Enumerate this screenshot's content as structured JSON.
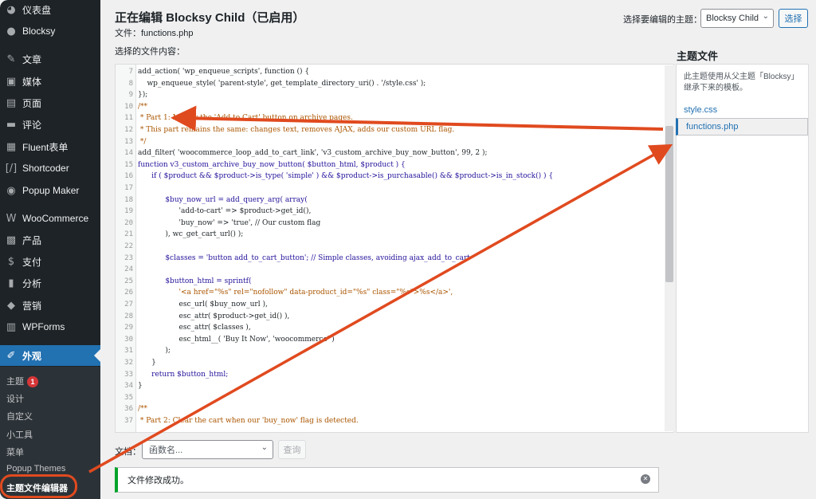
{
  "sidebar": {
    "items": [
      {
        "label": "仪表盘",
        "icon": "dashboard-icon",
        "glyph": "◕"
      },
      {
        "label": "Blocksy",
        "icon": "blocksy-icon",
        "glyph": "●"
      },
      {
        "label": "文章",
        "icon": "pin-icon",
        "glyph": "✎"
      },
      {
        "label": "媒体",
        "icon": "media-icon",
        "glyph": "▣"
      },
      {
        "label": "页面",
        "icon": "page-icon",
        "glyph": "▤"
      },
      {
        "label": "评论",
        "icon": "comment-icon",
        "glyph": "▬"
      },
      {
        "label": "Fluent表单",
        "icon": "form-icon",
        "glyph": "▦"
      },
      {
        "label": "Shortcoder",
        "icon": "shortcode-icon",
        "glyph": "[/]"
      },
      {
        "label": "Popup Maker",
        "icon": "popup-icon",
        "glyph": "◉"
      },
      {
        "label": "WooCommerce",
        "icon": "woocommerce-icon",
        "glyph": "W"
      },
      {
        "label": "产品",
        "icon": "product-icon",
        "glyph": "▩"
      },
      {
        "label": "支付",
        "icon": "payment-icon",
        "glyph": "$"
      },
      {
        "label": "分析",
        "icon": "analytics-icon",
        "glyph": "▮"
      },
      {
        "label": "营销",
        "icon": "marketing-icon",
        "glyph": "◆"
      },
      {
        "label": "WPForms",
        "icon": "wpforms-icon",
        "glyph": "▥"
      },
      {
        "label": "外观",
        "icon": "appearance-icon",
        "glyph": "✐"
      }
    ],
    "submenu": [
      {
        "label": "主题",
        "badge": "1"
      },
      {
        "label": "设计"
      },
      {
        "label": "自定义"
      },
      {
        "label": "小工具"
      },
      {
        "label": "菜单"
      },
      {
        "label": "Popup Themes"
      },
      {
        "label": "主题文件编辑器"
      }
    ]
  },
  "header": {
    "title": "正在编辑 Blocksy Child（已启用）",
    "file_label": "文件：",
    "file_name": "functions.php",
    "select_theme_label": "选择要编辑的主题：",
    "theme_selected": "Blocksy Child",
    "select_button": "选择"
  },
  "editor": {
    "label": "选择的文件内容：",
    "lines": [
      {
        "n": "7",
        "t": "add_action( 'wp_enqueue_scripts', function () {",
        "k": "plain"
      },
      {
        "n": "8",
        "t": "    wp_enqueue_style( 'parent-style', get_template_directory_uri() . '/style.css' );",
        "k": "plain"
      },
      {
        "n": "9",
        "t": "});",
        "k": "plain"
      },
      {
        "n": "10",
        "t": "/**",
        "k": "comment"
      },
      {
        "n": "11",
        "t": " * Part 1: Modify the 'Add to Cart' button on archive pages.",
        "k": "comment"
      },
      {
        "n": "12",
        "t": " * This part remains the same: changes text, removes AJAX, adds our custom URL flag.",
        "k": "comment"
      },
      {
        "n": "13",
        "t": " */",
        "k": "comment"
      },
      {
        "n": "14",
        "t": "add_filter( 'woocommerce_loop_add_to_cart_link', 'v3_custom_archive_buy_now_button', 99, 2 );",
        "k": "plain"
      },
      {
        "n": "15",
        "t": "function v3_custom_archive_buy_now_button( $button_html, $product ) {",
        "k": "kw"
      },
      {
        "n": "16",
        "t": "      if ( $product && $product->is_type( 'simple' ) && $product->is_purchasable() && $product->is_in_stock() ) {",
        "k": "kw"
      },
      {
        "n": "17",
        "t": "",
        "k": "plain"
      },
      {
        "n": "18",
        "t": "            $buy_now_url = add_query_arg( array(",
        "k": "kw"
      },
      {
        "n": "19",
        "t": "                  'add-to-cart' => $product->get_id(),",
        "k": "plain"
      },
      {
        "n": "20",
        "t": "                  'buy_now' => 'true', // Our custom flag",
        "k": "plain"
      },
      {
        "n": "21",
        "t": "            ), wc_get_cart_url() );",
        "k": "plain"
      },
      {
        "n": "22",
        "t": "",
        "k": "plain"
      },
      {
        "n": "23",
        "t": "            $classes = 'button add_to_cart_button'; // Simple classes, avoiding ajax_add_to_cart",
        "k": "kw"
      },
      {
        "n": "24",
        "t": "",
        "k": "plain"
      },
      {
        "n": "25",
        "t": "            $button_html = sprintf(",
        "k": "kw"
      },
      {
        "n": "26",
        "t": "                  '<a href=\"%s\" rel=\"nofollow\" data-product_id=\"%s\" class=\"%s\">%s</a>',",
        "k": "cm"
      },
      {
        "n": "27",
        "t": "                  esc_url( $buy_now_url ),",
        "k": "plain"
      },
      {
        "n": "28",
        "t": "                  esc_attr( $product->get_id() ),",
        "k": "plain"
      },
      {
        "n": "29",
        "t": "                  esc_attr( $classes ),",
        "k": "plain"
      },
      {
        "n": "30",
        "t": "                  esc_html__( 'Buy It Now', 'woocommerce' )",
        "k": "plain"
      },
      {
        "n": "31",
        "t": "            );",
        "k": "plain"
      },
      {
        "n": "32",
        "t": "      }",
        "k": "plain"
      },
      {
        "n": "33",
        "t": "      return $button_html;",
        "k": "kw"
      },
      {
        "n": "34",
        "t": "}",
        "k": "plain"
      },
      {
        "n": "35",
        "t": "",
        "k": "plain"
      },
      {
        "n": "36",
        "t": "/**",
        "k": "comment"
      },
      {
        "n": "37",
        "t": " * Part 2: Clear the cart when our 'buy_now' flag is detected.",
        "k": "comment"
      }
    ]
  },
  "side": {
    "title": "主题文件",
    "description": "此主题使用从父主题「Blocksy」继承下来的模板。",
    "files": [
      "style.css",
      "functions.php"
    ]
  },
  "footer": {
    "doc_label": "文档：",
    "doc_placeholder": "函数名...",
    "lookup_button": "查询",
    "notice": "文件修改成功。"
  },
  "colors": {
    "annotation": "#e04a1f",
    "accent": "#2271b1",
    "sidebar_bg": "#1d2327",
    "success": "#00a32a"
  }
}
